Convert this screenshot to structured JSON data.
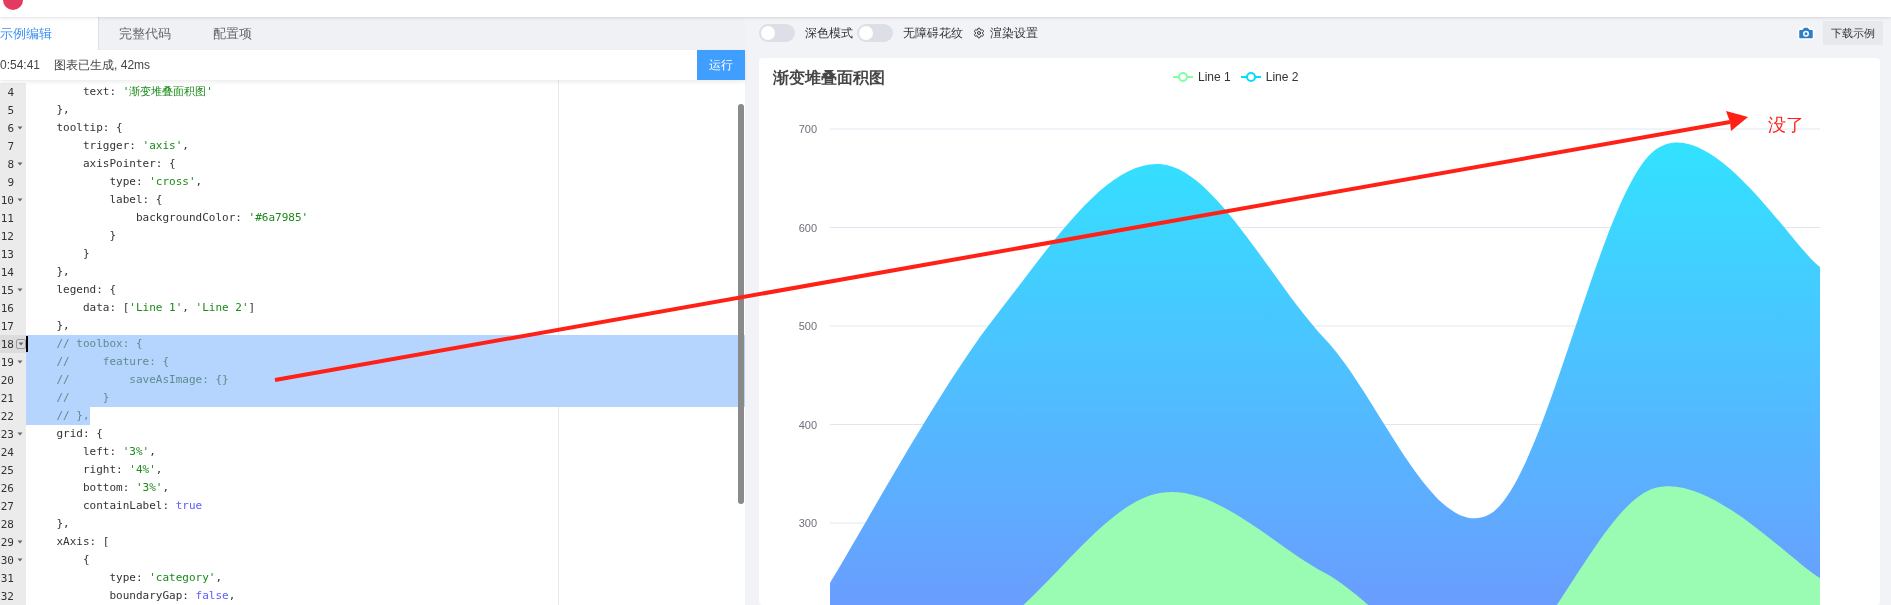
{
  "editor_tabs": [
    {
      "label": "示例编辑",
      "selected": true
    },
    {
      "label": "完整代码",
      "selected": false
    },
    {
      "label": "配置项",
      "selected": false
    }
  ],
  "status": {
    "time": "0:54:41",
    "message": "图表已生成, 42ms"
  },
  "run_button": "运行",
  "code_lines": [
    {
      "num": "4",
      "fold": false,
      "active": false,
      "selected": false,
      "parts": [
        {
          "kind": "plain",
          "text": "        text: "
        },
        {
          "kind": "string",
          "text": "'渐变堆叠面积图'"
        }
      ]
    },
    {
      "num": "5",
      "fold": false,
      "active": false,
      "selected": false,
      "parts": [
        {
          "kind": "plain",
          "text": "    },"
        }
      ]
    },
    {
      "num": "6",
      "fold": true,
      "active": false,
      "selected": false,
      "parts": [
        {
          "kind": "plain",
          "text": "    tooltip: {"
        }
      ]
    },
    {
      "num": "7",
      "fold": false,
      "active": false,
      "selected": false,
      "parts": [
        {
          "kind": "plain",
          "text": "        trigger: "
        },
        {
          "kind": "string",
          "text": "'axis'"
        },
        {
          "kind": "plain",
          "text": ","
        }
      ]
    },
    {
      "num": "8",
      "fold": true,
      "active": false,
      "selected": false,
      "parts": [
        {
          "kind": "plain",
          "text": "        axisPointer: {"
        }
      ]
    },
    {
      "num": "9",
      "fold": false,
      "active": false,
      "selected": false,
      "parts": [
        {
          "kind": "plain",
          "text": "            type: "
        },
        {
          "kind": "string",
          "text": "'cross'"
        },
        {
          "kind": "plain",
          "text": ","
        }
      ]
    },
    {
      "num": "10",
      "fold": true,
      "active": false,
      "selected": false,
      "parts": [
        {
          "kind": "plain",
          "text": "            label: {"
        }
      ]
    },
    {
      "num": "11",
      "fold": false,
      "active": false,
      "selected": false,
      "parts": [
        {
          "kind": "plain",
          "text": "                backgroundColor: "
        },
        {
          "kind": "string",
          "text": "'#6a7985'"
        }
      ]
    },
    {
      "num": "12",
      "fold": false,
      "active": false,
      "selected": false,
      "parts": [
        {
          "kind": "plain",
          "text": "            }"
        }
      ]
    },
    {
      "num": "13",
      "fold": false,
      "active": false,
      "selected": false,
      "parts": [
        {
          "kind": "plain",
          "text": "        }"
        }
      ]
    },
    {
      "num": "14",
      "fold": false,
      "active": false,
      "selected": false,
      "parts": [
        {
          "kind": "plain",
          "text": "    },"
        }
      ]
    },
    {
      "num": "15",
      "fold": true,
      "active": false,
      "selected": false,
      "parts": [
        {
          "kind": "plain",
          "text": "    legend: {"
        }
      ]
    },
    {
      "num": "16",
      "fold": false,
      "active": false,
      "selected": false,
      "parts": [
        {
          "kind": "plain",
          "text": "        data: ["
        },
        {
          "kind": "string",
          "text": "'Line 1'"
        },
        {
          "kind": "plain",
          "text": ", "
        },
        {
          "kind": "string",
          "text": "'Line 2'"
        },
        {
          "kind": "plain",
          "text": "]"
        }
      ]
    },
    {
      "num": "17",
      "fold": false,
      "active": false,
      "selected": false,
      "parts": [
        {
          "kind": "plain",
          "text": "    },"
        }
      ]
    },
    {
      "num": "18",
      "fold": true,
      "active": true,
      "selected": true,
      "parts": [
        {
          "kind": "comment",
          "text": "    // toolbox: {"
        }
      ]
    },
    {
      "num": "19",
      "fold": true,
      "active": false,
      "selected": true,
      "parts": [
        {
          "kind": "comment",
          "text": "    //     feature: {"
        }
      ]
    },
    {
      "num": "20",
      "fold": false,
      "active": false,
      "selected": true,
      "parts": [
        {
          "kind": "comment",
          "text": "    //         saveAsImage: {}"
        }
      ]
    },
    {
      "num": "21",
      "fold": false,
      "active": false,
      "selected": true,
      "parts": [
        {
          "kind": "comment",
          "text": "    //     }"
        }
      ]
    },
    {
      "num": "22",
      "fold": false,
      "active": false,
      "selected": true,
      "parts": [
        {
          "kind": "comment",
          "text": "    // },"
        }
      ]
    },
    {
      "num": "23",
      "fold": true,
      "active": false,
      "selected": false,
      "parts": [
        {
          "kind": "plain",
          "text": "    grid: {"
        }
      ]
    },
    {
      "num": "24",
      "fold": false,
      "active": false,
      "selected": false,
      "parts": [
        {
          "kind": "plain",
          "text": "        left: "
        },
        {
          "kind": "string",
          "text": "'3%'"
        },
        {
          "kind": "plain",
          "text": ","
        }
      ]
    },
    {
      "num": "25",
      "fold": false,
      "active": false,
      "selected": false,
      "parts": [
        {
          "kind": "plain",
          "text": "        right: "
        },
        {
          "kind": "string",
          "text": "'4%'"
        },
        {
          "kind": "plain",
          "text": ","
        }
      ]
    },
    {
      "num": "26",
      "fold": false,
      "active": false,
      "selected": false,
      "parts": [
        {
          "kind": "plain",
          "text": "        bottom: "
        },
        {
          "kind": "string",
          "text": "'3%'"
        },
        {
          "kind": "plain",
          "text": ","
        }
      ]
    },
    {
      "num": "27",
      "fold": false,
      "active": false,
      "selected": false,
      "parts": [
        {
          "kind": "plain",
          "text": "        containLabel: "
        },
        {
          "kind": "keyword",
          "text": "true"
        }
      ]
    },
    {
      "num": "28",
      "fold": false,
      "active": false,
      "selected": false,
      "parts": [
        {
          "kind": "plain",
          "text": "    },"
        }
      ]
    },
    {
      "num": "29",
      "fold": true,
      "active": false,
      "selected": false,
      "parts": [
        {
          "kind": "plain",
          "text": "    xAxis: ["
        }
      ]
    },
    {
      "num": "30",
      "fold": true,
      "active": false,
      "selected": false,
      "parts": [
        {
          "kind": "plain",
          "text": "        {"
        }
      ]
    },
    {
      "num": "31",
      "fold": false,
      "active": false,
      "selected": false,
      "parts": [
        {
          "kind": "plain",
          "text": "            type: "
        },
        {
          "kind": "string",
          "text": "'category'"
        },
        {
          "kind": "plain",
          "text": ","
        }
      ]
    },
    {
      "num": "32",
      "fold": false,
      "active": false,
      "selected": false,
      "parts": [
        {
          "kind": "plain",
          "text": "            boundaryGap: "
        },
        {
          "kind": "keyword",
          "text": "false"
        },
        {
          "kind": "plain",
          "text": ","
        }
      ]
    }
  ],
  "toolbar": {
    "toggles": [
      {
        "label": "深色模式",
        "on": false
      },
      {
        "label": "无障碍花纹",
        "on": false
      }
    ],
    "render_settings": "渲染设置",
    "download_button": "下载示例"
  },
  "chart": {
    "title": "渐变堆叠面积图",
    "legend": [
      {
        "name": "Line 1",
        "color": "#80ffa5"
      },
      {
        "name": "Line 2",
        "color": "#00ddff"
      }
    ],
    "y_labels": [
      "700",
      "600",
      "500",
      "400",
      "300"
    ]
  },
  "annotation": {
    "text": "没了"
  }
}
